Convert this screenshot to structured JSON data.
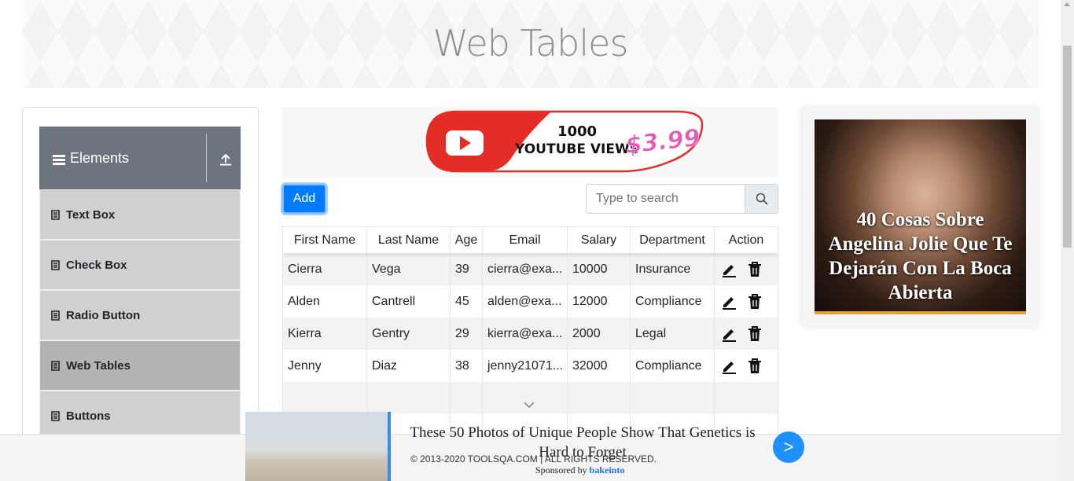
{
  "page": {
    "title": "Web Tables"
  },
  "sidebar": {
    "group_title": "Elements",
    "items": [
      {
        "label": "Text Box"
      },
      {
        "label": "Check Box"
      },
      {
        "label": "Radio Button"
      },
      {
        "label": "Web Tables"
      },
      {
        "label": "Buttons"
      }
    ],
    "active_item": "Web Tables"
  },
  "ad_top": {
    "count": "1000",
    "label": "YOUTUBE VIEWS",
    "price": "$3.99"
  },
  "toolbar": {
    "add_label": "Add",
    "search_placeholder": "Type to search"
  },
  "table": {
    "headers": [
      "First Name",
      "Last Name",
      "Age",
      "Email",
      "Salary",
      "Department",
      "Action"
    ],
    "rows": [
      {
        "first": "Cierra",
        "last": "Vega",
        "age": "39",
        "email": "cierra@exa...",
        "salary": "10000",
        "department": "Insurance"
      },
      {
        "first": "Alden",
        "last": "Cantrell",
        "age": "45",
        "email": "alden@exa...",
        "salary": "12000",
        "department": "Compliance"
      },
      {
        "first": "Kierra",
        "last": "Gentry",
        "age": "29",
        "email": "kierra@exa...",
        "salary": "2000",
        "department": "Legal"
      },
      {
        "first": "Jenny",
        "last": "Diaz",
        "age": "38",
        "email": "jenny21071...",
        "salary": "32000",
        "department": "Compliance"
      }
    ]
  },
  "ad_right": {
    "headline": "40 Cosas Sobre Angelina Jolie Que Te Dejarán Con La Boca Abierta"
  },
  "ad_bottom": {
    "headline": "These 50 Photos of Unique People Show That Genetics is Hard to Forget",
    "sponsored_prefix": "Sponsored by",
    "sponsor": "bakeinto",
    "next_label": ">"
  },
  "footer": {
    "text": "© 2013-2020 TOOLSQA.COM | ALL RIGHTS RESERVED."
  },
  "colors": {
    "accent": "#007bff",
    "sidebar_header": "#6c757d",
    "sidebar_item": "#d0d0d0",
    "sidebar_item_active": "#b4b4b4"
  }
}
